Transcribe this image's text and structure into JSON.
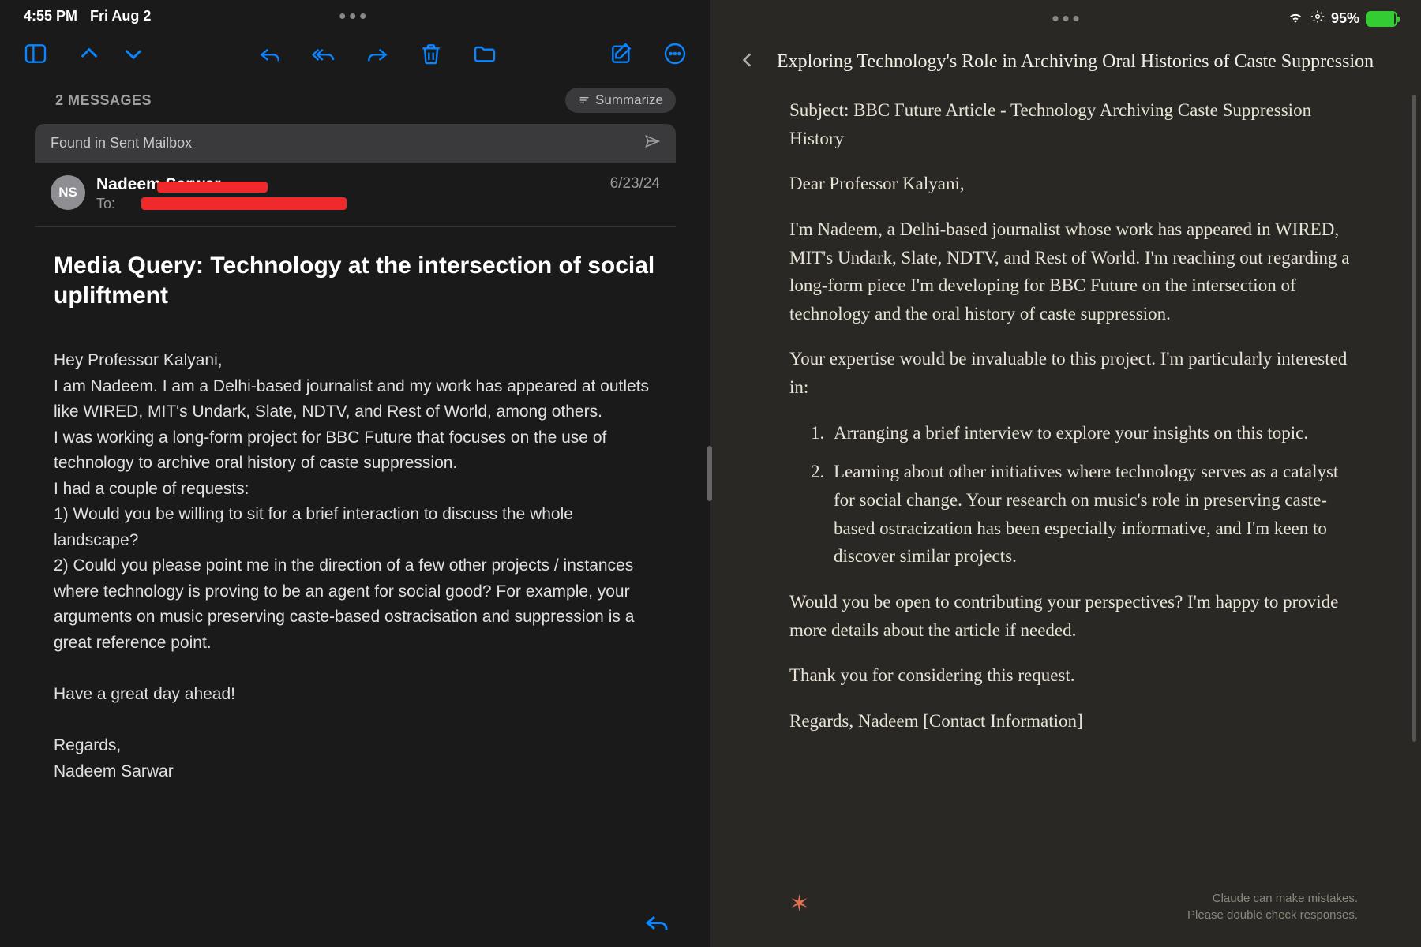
{
  "status": {
    "time": "4:55 PM",
    "date": "Fri Aug 2",
    "battery_pct": "95%"
  },
  "mail": {
    "count_label": "2 MESSAGES",
    "summarize": "Summarize",
    "found_banner": "Found in Sent Mailbox",
    "sender": {
      "initials": "NS",
      "name": "Nadeem Sarwar",
      "to_label": "To:",
      "date": "6/23/24"
    },
    "subject": "Media Query: Technology at the intersection of social upliftment",
    "body": {
      "greeting": "Hey Professor Kalyani,",
      "p1": "I am Nadeem. I am a Delhi-based journalist and my work has appeared at outlets like WIRED, MIT's Undark, Slate, NDTV, and Rest of World, among others.",
      "p2": "I was working a long-form project for BBC Future that focuses on the use of technology to archive oral history of caste suppression.",
      "p3": "I had a couple of requests:",
      "p4": "1) Would you be willing to sit for a brief interaction to discuss the whole landscape?",
      "p5": "2) Could you please point me in the direction of a few other projects / instances where technology is proving to be an agent for social good? For example, your arguments on music preserving caste-based ostracisation and suppression is a great reference point.",
      "p6": "Have a great day ahead!",
      "p7": "Regards,",
      "p8": "Nadeem Sarwar"
    }
  },
  "assistant": {
    "title": "Exploring Technology's Role in Archiving Oral Histories of Caste Suppression",
    "subject": "Subject: BBC Future Article - Technology Archiving Caste Suppression History",
    "greeting": "Dear Professor Kalyani,",
    "p1": "I'm Nadeem, a Delhi-based journalist whose work has appeared in WIRED, MIT's Undark, Slate, NDTV, and Rest of World. I'm reaching out regarding a long-form piece I'm developing for BBC Future on the intersection of technology and the oral history of caste suppression.",
    "p2": "Your expertise would be invaluable to this project. I'm particularly interested in:",
    "li1": "Arranging a brief interview to explore your insights on this topic.",
    "li2": "Learning about other initiatives where technology serves as a catalyst for social change. Your research on music's role in preserving caste-based ostracization has been especially informative, and I'm keen to discover similar projects.",
    "p3": "Would you be open to contributing your perspectives? I'm happy to provide more details about the article if needed.",
    "p4": "Thank you for considering this request.",
    "p5": "Regards, Nadeem [Contact Information]",
    "disclaimer1": "Claude can make mistakes.",
    "disclaimer2": "Please double check responses."
  }
}
